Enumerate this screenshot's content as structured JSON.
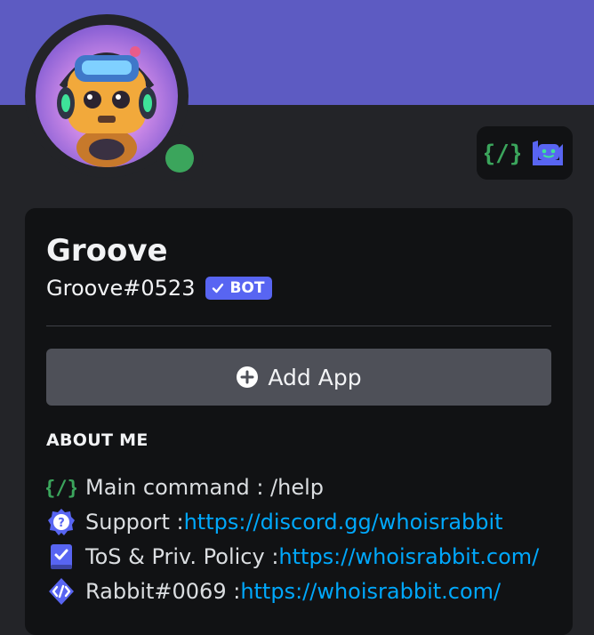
{
  "profile": {
    "name": "Groove",
    "tag": "Groove#0523",
    "bot_badge": "BOT",
    "status": "online"
  },
  "badges": [
    {
      "icon": "slash-commands-icon"
    },
    {
      "icon": "bot-app-icon"
    }
  ],
  "actions": {
    "add_app": "Add App"
  },
  "about": {
    "title": "ABOUT ME",
    "lines": [
      {
        "icon": "slash-commands-icon",
        "text": "Main command : /help",
        "link": ""
      },
      {
        "icon": "help-badge-icon",
        "text": "Support : ",
        "link": "https://discord.gg/whoisrabbit"
      },
      {
        "icon": "rules-book-icon",
        "text": "ToS & Priv. Policy : ",
        "link": "https://whoisrabbit.com/"
      },
      {
        "icon": "developer-badge-icon",
        "text": "Rabbit#0069 : ",
        "link": "https://whoisrabbit.com/"
      }
    ]
  },
  "colors": {
    "banner": "#5d5bc2",
    "background": "#232428",
    "card": "#111214",
    "accent": "#5865f2",
    "link": "#00a8fc",
    "online": "#3ba55c"
  }
}
